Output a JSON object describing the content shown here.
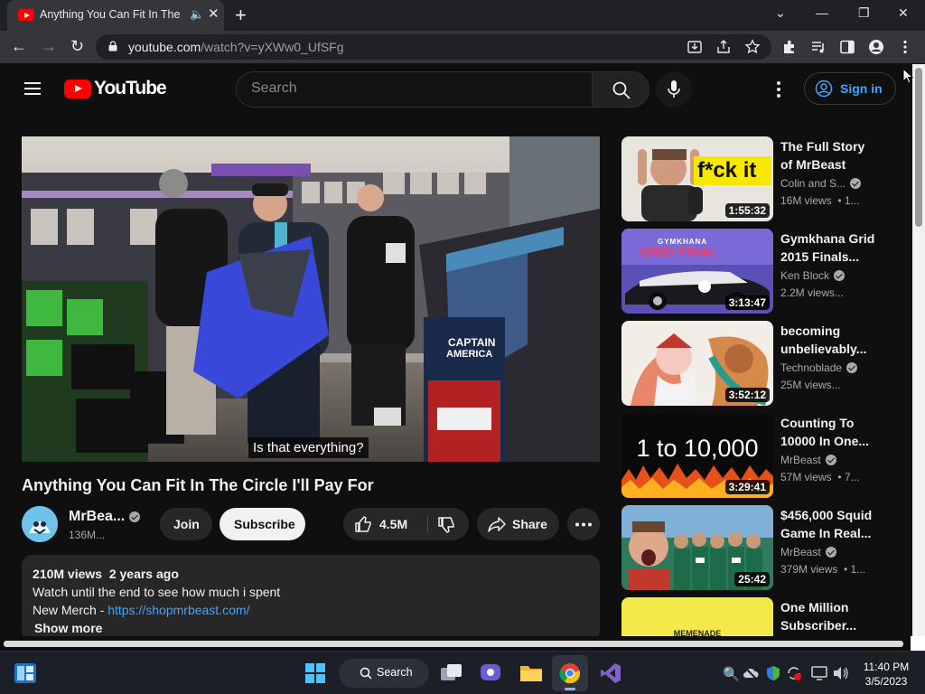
{
  "browser": {
    "tab_title": "Anything You Can Fit In The C",
    "url_domain": "youtube.com",
    "url_path": "/watch?v=yXWw0_UfSFg"
  },
  "header": {
    "logo_text": "YouTube",
    "search_placeholder": "Search",
    "sign_in": "Sign in"
  },
  "video": {
    "caption": "Is that everything?",
    "title": "Anything You Can Fit In The Circle I'll Pay For",
    "channel": "MrBea...",
    "subscribers": "136M...",
    "join": "Join",
    "subscribe": "Subscribe",
    "likes": "4.5M",
    "share": "Share",
    "views_date": "210M views  2 years ago",
    "desc_line1": "Watch until the end to see how much i spent",
    "desc_merch": "New Merch - ",
    "desc_link": "https://shopmrbeast.com/",
    "show_more": "Show more"
  },
  "recommendations": [
    {
      "title1": "The Full Story",
      "title2": "of MrBeast",
      "channel": "Colin and S...",
      "views": "16M views  • 1...",
      "duration": "1:55:32",
      "thumb_text": "f*ck it"
    },
    {
      "title1": "Gymkhana Grid",
      "title2": "2015 Finals...",
      "channel": "Ken Block",
      "views": "2.2M views...",
      "duration": "3:13:47",
      "thumb_text": "GRID FINAL",
      "thumb_sub": "GYMKHANA"
    },
    {
      "title1": "becoming",
      "title2": "unbelievably...",
      "channel": "Technoblade",
      "views": "25M views...",
      "duration": "3:52:12"
    },
    {
      "title1": "Counting To",
      "title2": "10000 In One...",
      "channel": "MrBeast",
      "views": "57M views  • 7...",
      "duration": "3:29:41",
      "thumb_text": "1 to 10,000"
    },
    {
      "title1": "$456,000 Squid",
      "title2": "Game In Real...",
      "channel": "MrBeast",
      "views": "379M views  • 1...",
      "duration": "25:42"
    },
    {
      "title1": "One Million",
      "title2": "Subscriber...",
      "thumb_text": "MEMENADE"
    }
  ],
  "taskbar": {
    "search": "Search",
    "time": "11:40 PM",
    "date": "3/5/2023"
  },
  "colors": {
    "youtube_red": "#ff0000",
    "link_blue": "#3ea6ff",
    "page_bg": "#0f0f0f"
  }
}
